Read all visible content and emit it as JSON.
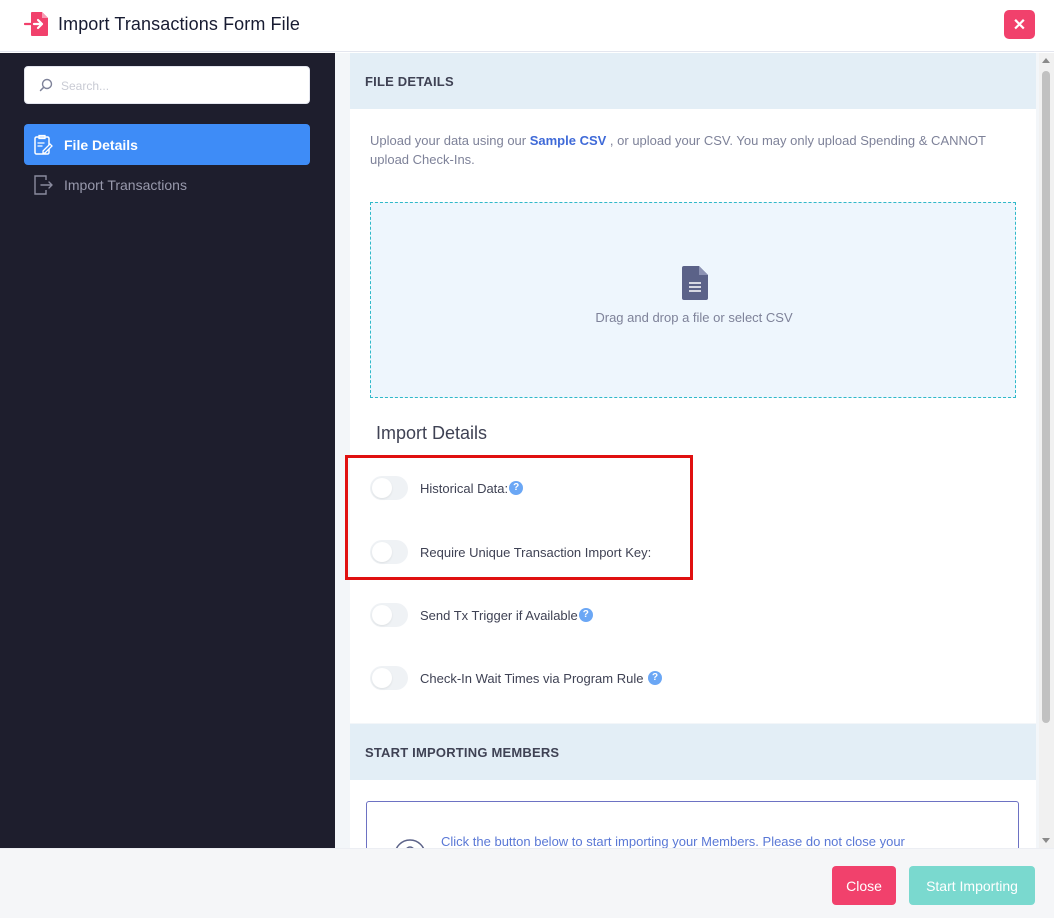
{
  "header": {
    "title": "Import Transactions Form File",
    "icon": "import-file-icon",
    "close_icon": "close-icon",
    "close_symbol": "✕"
  },
  "sidebar": {
    "search": {
      "placeholder": "Search...",
      "value": ""
    },
    "items": [
      {
        "label": "File Details",
        "icon": "file-details-icon",
        "active": true
      },
      {
        "label": "Import Transactions",
        "icon": "export-icon",
        "active": false
      }
    ]
  },
  "main": {
    "file_details": {
      "section_title": "FILE DETAILS",
      "intro_before": "Upload your data using our ",
      "intro_link": "Sample CSV",
      "intro_after": " , or upload your CSV. You may only upload Spending & CANNOT upload Check-Ins.",
      "dropzone_text": "Drag and drop a file or select CSV",
      "dropzone_icon": "document-icon"
    },
    "import_details": {
      "title": "Import Details",
      "toggles": [
        {
          "label": "Historical Data:",
          "checked": false,
          "help": true
        },
        {
          "label": "Require Unique Transaction Import Key:",
          "checked": false,
          "help": false
        },
        {
          "label": "Send Tx Trigger if Available",
          "checked": false,
          "help": true
        },
        {
          "label": "Check-In Wait Times via Program Rule",
          "checked": false,
          "help": true
        }
      ],
      "help_symbol": "?"
    },
    "start_importing": {
      "section_title": "START IMPORTING MEMBERS",
      "info_text": "Click the button below to start importing your Members. Please do not close your"
    }
  },
  "footer": {
    "close_label": "Close",
    "start_label": "Start Importing"
  },
  "colors": {
    "accent": "#3e8cf7",
    "danger": "#f1416c",
    "success_disabled": "#7ad9cf",
    "sidebar_bg": "#1e1e2d",
    "highlight": "#e01010"
  }
}
